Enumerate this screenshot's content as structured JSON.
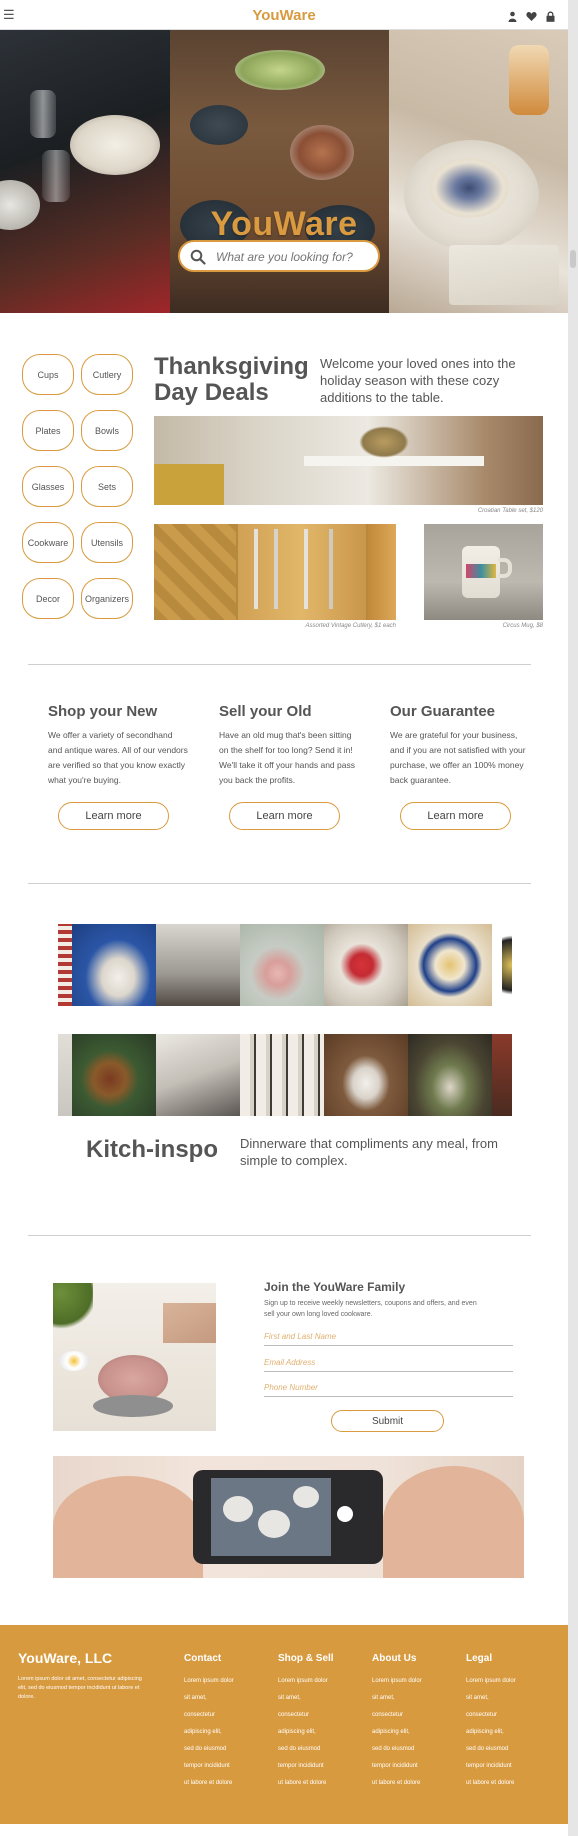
{
  "nav": {
    "menu_icon": "hamburger-icon",
    "brand": "YouWare",
    "icons": [
      "user-icon",
      "heart-icon",
      "lock-icon"
    ]
  },
  "hero": {
    "title": "YouWare",
    "search_placeholder": "What are you looking for?"
  },
  "categories": [
    "Cups",
    "Cutlery",
    "Plates",
    "Bowls",
    "Glasses",
    "Sets",
    "Cookware",
    "Utensils",
    "Decor",
    "Organizers"
  ],
  "deals": {
    "title": "Thanksgiving Day Deals",
    "description": "Welcome your loved ones into the holiday season with these cozy additions to the table.",
    "captions": [
      "Croatian Table set, $120",
      "Assorted Vintage Cutlery, $1 each",
      "Circus Mug, $8"
    ]
  },
  "features": [
    {
      "title": "Shop your New",
      "text": "We offer a variety of secondhand and antique wares. All of our vendors are verified so that you know exactly what you're buying.",
      "button": "Learn more"
    },
    {
      "title": "Sell your Old",
      "text": "Have an old mug that's been sitting on the shelf for too long? Send it in! We'll take it off your hands and pass you back the profits.",
      "button": "Learn more"
    },
    {
      "title": "Our Guarantee",
      "text": "We are grateful for your business, and if you are not satisfied with your purchase, we offer an 100% money back guarantee.",
      "button": "Learn more"
    }
  ],
  "inspo": {
    "title": "Kitch-inspo",
    "description": "Dinnerware that compliments any meal, from simple to complex."
  },
  "join": {
    "title": "Join the YouWare Family",
    "description": "Sign up to receive weekly newsletters, coupons and offers, and even sell your own long loved cookware.",
    "fields": [
      "First and Last Name",
      "Email Address",
      "Phone Number"
    ],
    "submit": "Submit"
  },
  "footer": {
    "brand": "YouWare, LLC",
    "blurb": "Lorem ipsum dolor sit amet, consectetur adipiscing elit, sed do eiusmod tempor incididunt ut labore et dolore.",
    "columns": [
      {
        "title": "Contact",
        "lines": [
          "Lorem ipsum dolor",
          "sit amet,",
          "consectetur",
          "adipiscing elit,",
          "sed do eiusmod",
          "tempor incididunt",
          "ut labore et dolore"
        ]
      },
      {
        "title": "Shop & Sell",
        "lines": [
          "Lorem ipsum dolor",
          "sit amet,",
          "consectetur",
          "adipiscing elit,",
          "sed do eiusmod",
          "tempor incididunt",
          "ut labore et dolore"
        ]
      },
      {
        "title": "About Us",
        "lines": [
          "Lorem ipsum dolor",
          "sit amet,",
          "consectetur",
          "adipiscing elit,",
          "sed do eiusmod",
          "tempor incididunt",
          "ut labore et dolore"
        ]
      },
      {
        "title": "Legal",
        "lines": [
          "Lorem ipsum dolor",
          "sit amet,",
          "consectetur",
          "adipiscing elit,",
          "sed do eiusmod",
          "tempor incididunt",
          "ut labore et dolore"
        ]
      }
    ]
  },
  "colors": {
    "accent": "#d89a3f",
    "text": "#555555",
    "background": "#ffffff"
  }
}
